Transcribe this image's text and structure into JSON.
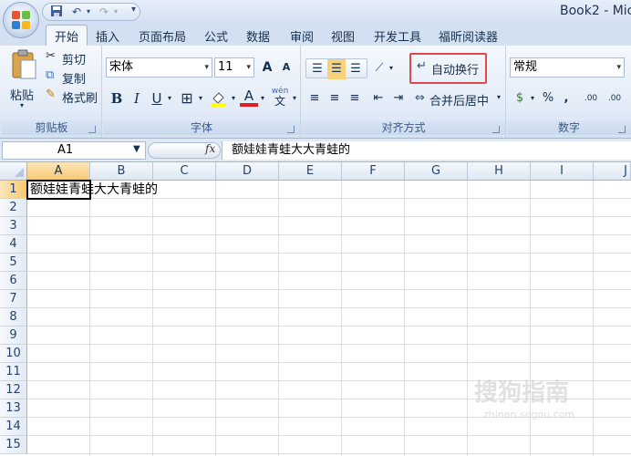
{
  "window": {
    "title": "Book2 - Mic"
  },
  "qat": {
    "save_icon": "save-icon",
    "undo_icon": "undo-icon",
    "redo_icon": "redo-icon",
    "customize_icon": "customize-qat-icon"
  },
  "tabs": [
    {
      "label": "开始"
    },
    {
      "label": "插入"
    },
    {
      "label": "页面布局"
    },
    {
      "label": "公式"
    },
    {
      "label": "数据"
    },
    {
      "label": "审阅"
    },
    {
      "label": "视图"
    },
    {
      "label": "开发工具"
    },
    {
      "label": "福昕阅读器"
    }
  ],
  "ribbon": {
    "clipboard": {
      "label": "剪贴板",
      "paste": "粘贴",
      "cut": "剪切",
      "copy": "复制",
      "format_painter": "格式刷"
    },
    "font": {
      "label": "字体",
      "font_name": "宋体",
      "font_size": "11",
      "grow": "A",
      "shrink": "A",
      "bold": "B",
      "italic": "I",
      "underline": "U",
      "font_color": "A",
      "phonetic": "wén"
    },
    "alignment": {
      "label": "对齐方式",
      "wrap_text": "自动换行",
      "merge_center": "合并后居中"
    },
    "number": {
      "label": "数字",
      "format": "常规",
      "percent": "%",
      "comma": ",",
      "inc_decimal": ".00",
      "dec_decimal": ".00"
    }
  },
  "colors": {
    "highlight": "#e0484e",
    "selection": "#f8c873",
    "accent": "#15304f"
  },
  "formula_bar": {
    "name_box": "A1",
    "fx": "fx",
    "content": "额娃娃青蛙大大青蛙的"
  },
  "grid": {
    "columns": [
      "A",
      "B",
      "C",
      "D",
      "E",
      "F",
      "G",
      "H",
      "I",
      "J"
    ],
    "rows": [
      "1",
      "2",
      "3",
      "4",
      "5",
      "6",
      "7",
      "8",
      "9",
      "10",
      "11",
      "12",
      "13",
      "14",
      "15"
    ],
    "cell_a1": "额娃娃青蛙大大青蛙的"
  },
  "watermark": {
    "text": "搜狗指南",
    "sub": "zhinan.sogou.com"
  }
}
